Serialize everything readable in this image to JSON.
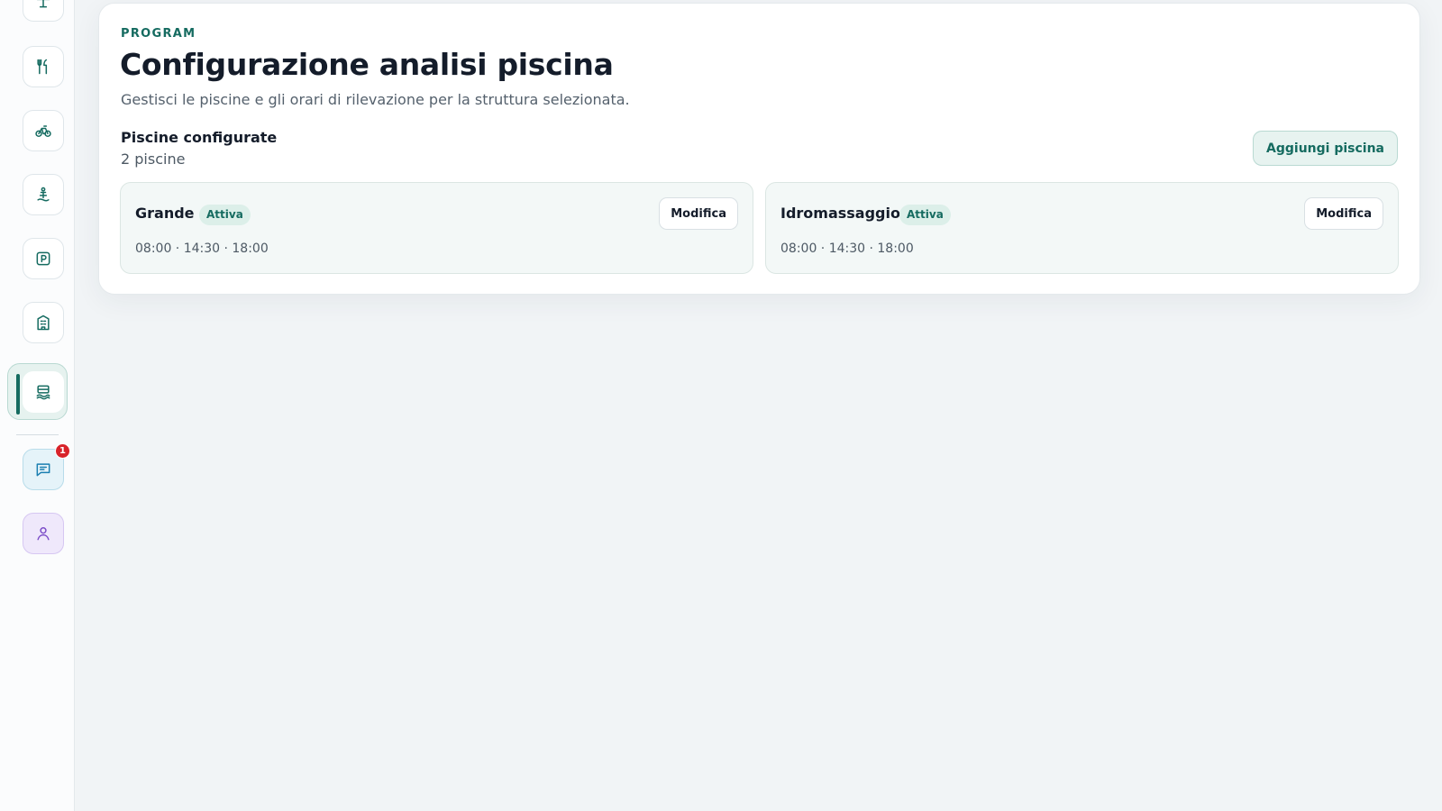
{
  "sidebar": {
    "items": [
      {
        "icon": "beach-umbrella-icon"
      },
      {
        "icon": "restaurant-icon"
      },
      {
        "icon": "bicycle-icon"
      },
      {
        "icon": "lifeguard-icon"
      },
      {
        "icon": "parking-icon"
      },
      {
        "icon": "building-icon"
      },
      {
        "icon": "pool-icon",
        "active": true
      }
    ],
    "chat": {
      "icon": "chat-icon",
      "badge": "1"
    },
    "user": {
      "icon": "user-icon"
    }
  },
  "header": {
    "eyebrow": "PROGRAM",
    "title": "Configurazione analisi piscina",
    "subtitle": "Gestisci le piscine e gli orari di rilevazione per la struttura selezionata."
  },
  "section": {
    "title": "Piscine configurate",
    "count": "2 piscine",
    "add_label": "Aggiungi piscina"
  },
  "pools": [
    {
      "name": "Grande",
      "status": "Attiva",
      "times": "08:00 · 14:30 · 18:00",
      "edit_label": "Modifica"
    },
    {
      "name": "Idromassaggio",
      "status": "Attiva",
      "times": "08:00 · 14:30 · 18:00",
      "edit_label": "Modifica"
    }
  ],
  "colors": {
    "accent": "#156b60",
    "badge_bg": "#dcefe9",
    "notification": "#d8232a"
  }
}
